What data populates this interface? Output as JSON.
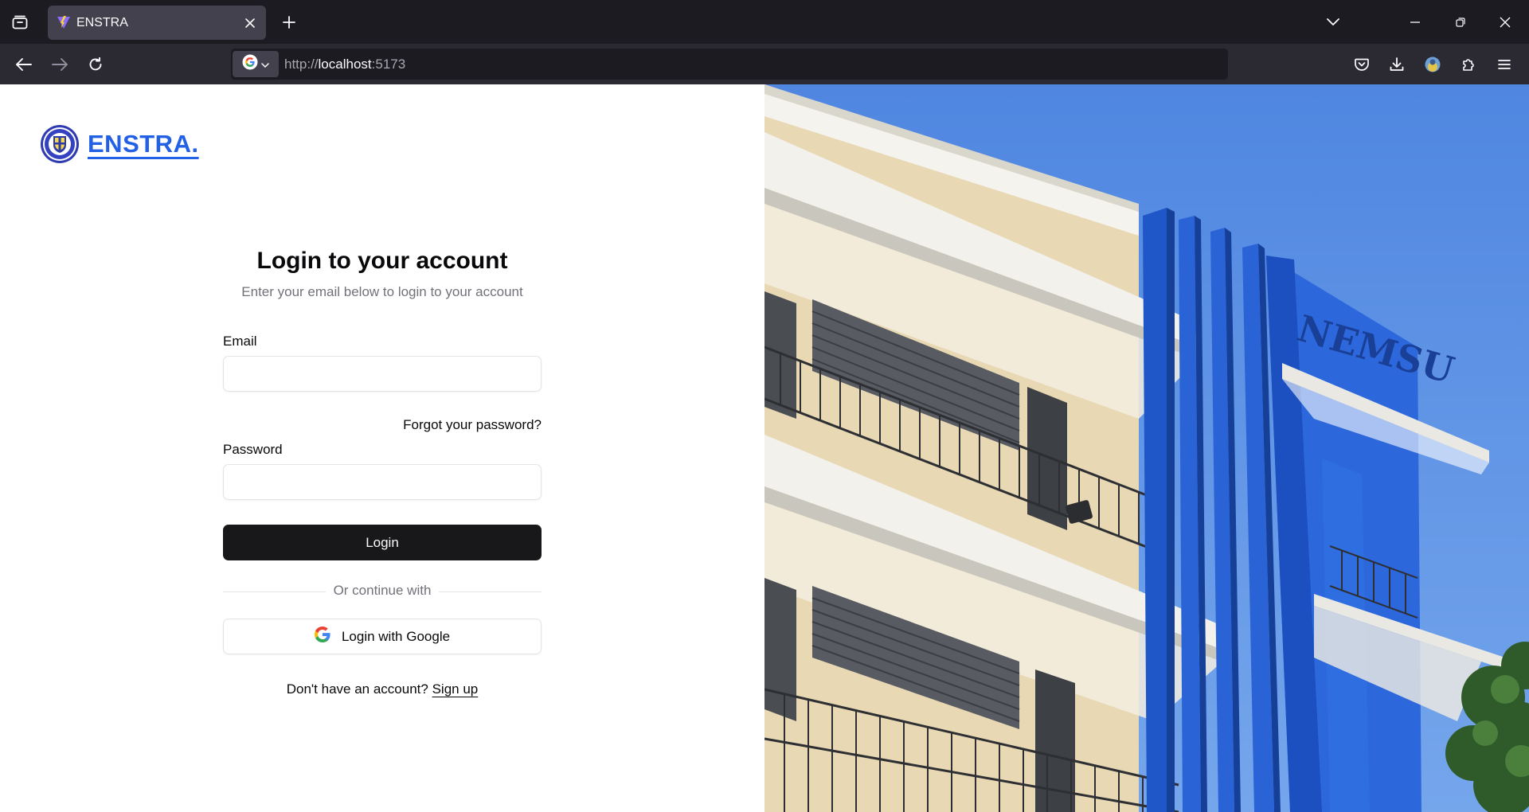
{
  "browser": {
    "tab_title": "ENSTRA",
    "url_prefix": "http://",
    "url_host": "localhost",
    "url_suffix": ":5173"
  },
  "brand": {
    "name": "ENSTRA.",
    "color": "#2260e6"
  },
  "login": {
    "title": "Login to your account",
    "subtitle": "Enter your email below to login to your account",
    "email_label": "Email",
    "email_value": "",
    "forgot_link": "Forgot your password?",
    "password_label": "Password",
    "password_value": "",
    "login_button": "Login",
    "divider_text": "Or continue with",
    "google_button": "Login with Google",
    "signup_prompt": "Don't have an account?",
    "signup_link": "Sign up"
  },
  "hero": {
    "building_sign": "NEMSU",
    "accent_color": "#1f56c8",
    "sky_color": "#5a93e4"
  }
}
